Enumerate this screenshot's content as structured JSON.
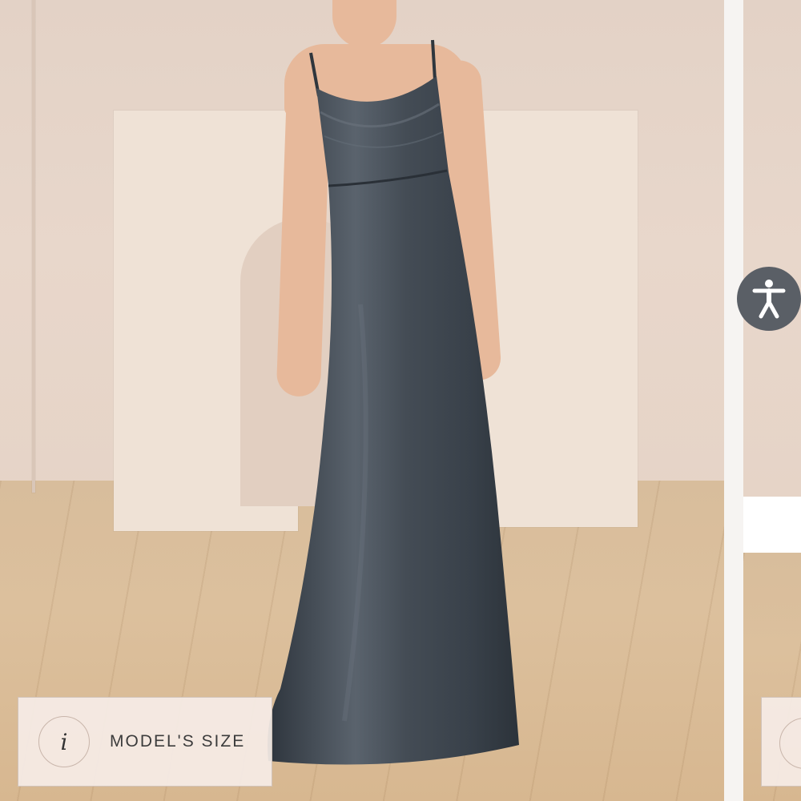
{
  "gallery": {
    "main_image_alt": "",
    "model_size_label": "MODEL'S SIZE",
    "info_icon_glyph": "i"
  },
  "accessibility": {
    "icon": "accessibility-person-icon"
  },
  "colors": {
    "dress": "#444c55",
    "wall": "#e5d4c8",
    "floor": "#d8bc98",
    "accessibility_button": "#5a5f66"
  }
}
